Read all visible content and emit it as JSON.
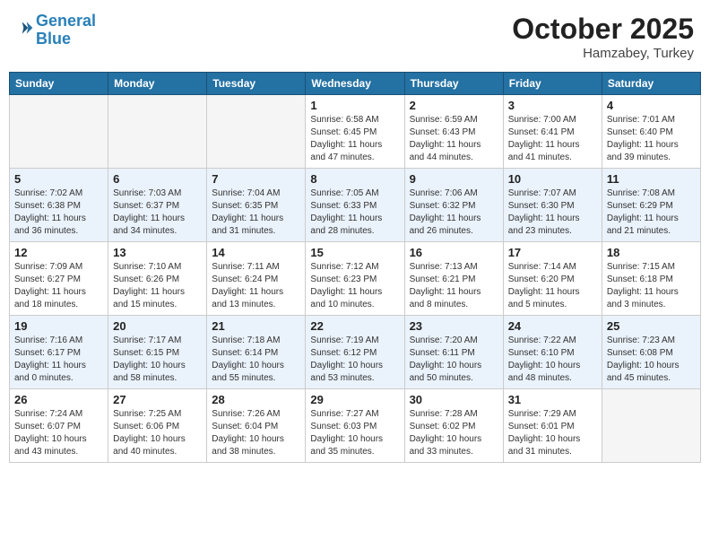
{
  "header": {
    "logo_line1": "General",
    "logo_line2": "Blue",
    "month": "October 2025",
    "location": "Hamzabey, Turkey"
  },
  "weekdays": [
    "Sunday",
    "Monday",
    "Tuesday",
    "Wednesday",
    "Thursday",
    "Friday",
    "Saturday"
  ],
  "weeks": [
    [
      {
        "day": "",
        "info": ""
      },
      {
        "day": "",
        "info": ""
      },
      {
        "day": "",
        "info": ""
      },
      {
        "day": "1",
        "info": "Sunrise: 6:58 AM\nSunset: 6:45 PM\nDaylight: 11 hours\nand 47 minutes."
      },
      {
        "day": "2",
        "info": "Sunrise: 6:59 AM\nSunset: 6:43 PM\nDaylight: 11 hours\nand 44 minutes."
      },
      {
        "day": "3",
        "info": "Sunrise: 7:00 AM\nSunset: 6:41 PM\nDaylight: 11 hours\nand 41 minutes."
      },
      {
        "day": "4",
        "info": "Sunrise: 7:01 AM\nSunset: 6:40 PM\nDaylight: 11 hours\nand 39 minutes."
      }
    ],
    [
      {
        "day": "5",
        "info": "Sunrise: 7:02 AM\nSunset: 6:38 PM\nDaylight: 11 hours\nand 36 minutes."
      },
      {
        "day": "6",
        "info": "Sunrise: 7:03 AM\nSunset: 6:37 PM\nDaylight: 11 hours\nand 34 minutes."
      },
      {
        "day": "7",
        "info": "Sunrise: 7:04 AM\nSunset: 6:35 PM\nDaylight: 11 hours\nand 31 minutes."
      },
      {
        "day": "8",
        "info": "Sunrise: 7:05 AM\nSunset: 6:33 PM\nDaylight: 11 hours\nand 28 minutes."
      },
      {
        "day": "9",
        "info": "Sunrise: 7:06 AM\nSunset: 6:32 PM\nDaylight: 11 hours\nand 26 minutes."
      },
      {
        "day": "10",
        "info": "Sunrise: 7:07 AM\nSunset: 6:30 PM\nDaylight: 11 hours\nand 23 minutes."
      },
      {
        "day": "11",
        "info": "Sunrise: 7:08 AM\nSunset: 6:29 PM\nDaylight: 11 hours\nand 21 minutes."
      }
    ],
    [
      {
        "day": "12",
        "info": "Sunrise: 7:09 AM\nSunset: 6:27 PM\nDaylight: 11 hours\nand 18 minutes."
      },
      {
        "day": "13",
        "info": "Sunrise: 7:10 AM\nSunset: 6:26 PM\nDaylight: 11 hours\nand 15 minutes."
      },
      {
        "day": "14",
        "info": "Sunrise: 7:11 AM\nSunset: 6:24 PM\nDaylight: 11 hours\nand 13 minutes."
      },
      {
        "day": "15",
        "info": "Sunrise: 7:12 AM\nSunset: 6:23 PM\nDaylight: 11 hours\nand 10 minutes."
      },
      {
        "day": "16",
        "info": "Sunrise: 7:13 AM\nSunset: 6:21 PM\nDaylight: 11 hours\nand 8 minutes."
      },
      {
        "day": "17",
        "info": "Sunrise: 7:14 AM\nSunset: 6:20 PM\nDaylight: 11 hours\nand 5 minutes."
      },
      {
        "day": "18",
        "info": "Sunrise: 7:15 AM\nSunset: 6:18 PM\nDaylight: 11 hours\nand 3 minutes."
      }
    ],
    [
      {
        "day": "19",
        "info": "Sunrise: 7:16 AM\nSunset: 6:17 PM\nDaylight: 11 hours\nand 0 minutes."
      },
      {
        "day": "20",
        "info": "Sunrise: 7:17 AM\nSunset: 6:15 PM\nDaylight: 10 hours\nand 58 minutes."
      },
      {
        "day": "21",
        "info": "Sunrise: 7:18 AM\nSunset: 6:14 PM\nDaylight: 10 hours\nand 55 minutes."
      },
      {
        "day": "22",
        "info": "Sunrise: 7:19 AM\nSunset: 6:12 PM\nDaylight: 10 hours\nand 53 minutes."
      },
      {
        "day": "23",
        "info": "Sunrise: 7:20 AM\nSunset: 6:11 PM\nDaylight: 10 hours\nand 50 minutes."
      },
      {
        "day": "24",
        "info": "Sunrise: 7:22 AM\nSunset: 6:10 PM\nDaylight: 10 hours\nand 48 minutes."
      },
      {
        "day": "25",
        "info": "Sunrise: 7:23 AM\nSunset: 6:08 PM\nDaylight: 10 hours\nand 45 minutes."
      }
    ],
    [
      {
        "day": "26",
        "info": "Sunrise: 7:24 AM\nSunset: 6:07 PM\nDaylight: 10 hours\nand 43 minutes."
      },
      {
        "day": "27",
        "info": "Sunrise: 7:25 AM\nSunset: 6:06 PM\nDaylight: 10 hours\nand 40 minutes."
      },
      {
        "day": "28",
        "info": "Sunrise: 7:26 AM\nSunset: 6:04 PM\nDaylight: 10 hours\nand 38 minutes."
      },
      {
        "day": "29",
        "info": "Sunrise: 7:27 AM\nSunset: 6:03 PM\nDaylight: 10 hours\nand 35 minutes."
      },
      {
        "day": "30",
        "info": "Sunrise: 7:28 AM\nSunset: 6:02 PM\nDaylight: 10 hours\nand 33 minutes."
      },
      {
        "day": "31",
        "info": "Sunrise: 7:29 AM\nSunset: 6:01 PM\nDaylight: 10 hours\nand 31 minutes."
      },
      {
        "day": "",
        "info": ""
      }
    ]
  ]
}
